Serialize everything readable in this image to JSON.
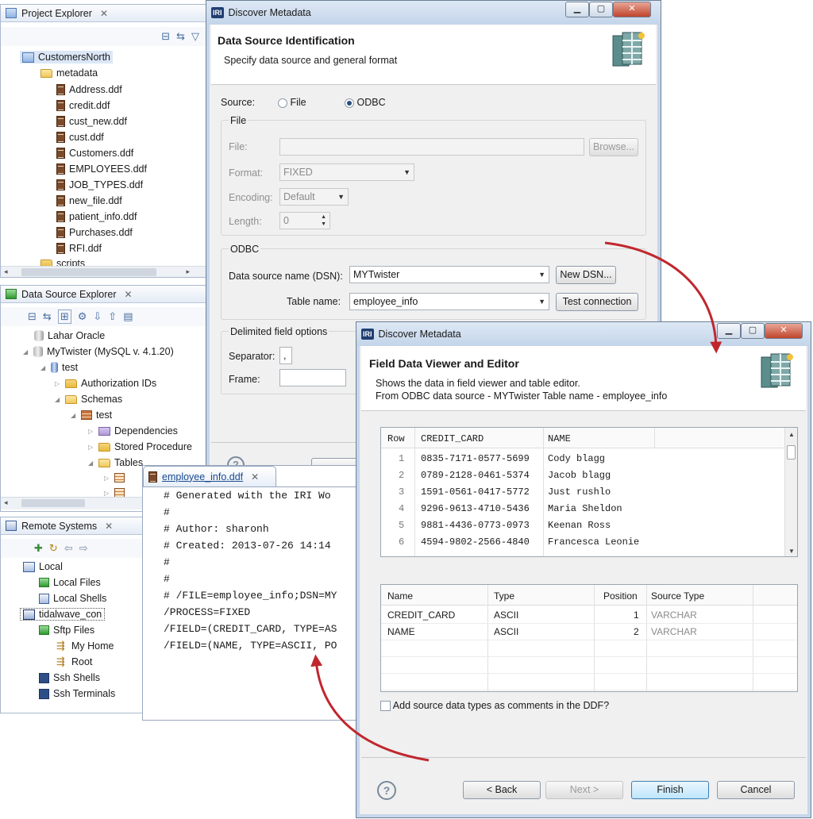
{
  "project_explorer": {
    "title": "Project Explorer",
    "project": "CustomersNorth",
    "folder": "metadata",
    "files": [
      "Address.ddf",
      "credit.ddf",
      "cust_new.ddf",
      "cust.ddf",
      "Customers.ddf",
      "EMPLOYEES.ddf",
      "JOB_TYPES.ddf",
      "new_file.ddf",
      "patient_info.ddf",
      "Purchases.ddf",
      "RFI.ddf"
    ],
    "partial_folder": "scripts"
  },
  "data_source_explorer": {
    "title": "Data Source Explorer",
    "items": [
      "Lahar Oracle",
      "MyTwister (MySQL v. 4.1.20)",
      "test",
      "Authorization IDs",
      "Schemas",
      "test",
      "Dependencies",
      "Stored Procedure",
      "Tables"
    ]
  },
  "remote_systems": {
    "title": "Remote Systems",
    "items": [
      "Local",
      "Local Files",
      "Local Shells",
      "tidalwave_con",
      "Sftp Files",
      "My Home",
      "Root",
      "Ssh Shells",
      "Ssh Terminals"
    ]
  },
  "discover_dialog": {
    "window_title": "Discover Metadata",
    "banner_title": "Data Source Identification",
    "banner_subtitle": "Specify data source and general format",
    "source_label": "Source:",
    "source_file": "File",
    "source_odbc": "ODBC",
    "file_group": "File",
    "file_label": "File:",
    "browse": "Browse...",
    "format_label": "Format:",
    "format_value": "FIXED",
    "encoding_label": "Encoding:",
    "encoding_value": "Default",
    "length_label": "Length:",
    "length_value": "0",
    "odbc_group": "ODBC",
    "dsn_label": "Data source name (DSN):",
    "dsn_value": "MYTwister",
    "new_dsn": "New DSN...",
    "table_label": "Table name:",
    "table_value": "employee_info",
    "test_connection": "Test connection",
    "delimited_group": "Delimited field options",
    "separator_label": "Separator:",
    "separator_value": ",",
    "frame_label": "Frame:"
  },
  "editor": {
    "tab": "employee_info.ddf",
    "lines": [
      "# Generated with the IRI Wo",
      "#",
      "# Author: sharonh",
      "# Created: 2013-07-26 14:14",
      "#",
      "#",
      "# /FILE=employee_info;DSN=MY",
      "/PROCESS=FIXED",
      "/FIELD=(CREDIT_CARD, TYPE=AS",
      "/FIELD=(NAME, TYPE=ASCII, PO"
    ]
  },
  "field_dialog": {
    "window_title": "Discover Metadata",
    "banner_title": "Field Data Viewer and Editor",
    "banner_line1": "Shows the data in field viewer and table editor.",
    "banner_line2": "From ODBC data source - MYTwister Table name - employee_info",
    "data_headers": [
      "Row",
      "CREDIT_CARD",
      "NAME"
    ],
    "data_rows": [
      [
        "1",
        "0835-7171-0577-5699",
        "Cody blagg"
      ],
      [
        "2",
        "0789-2128-0461-5374",
        "Jacob blagg"
      ],
      [
        "3",
        "1591-0561-0417-5772",
        "Just rushlo"
      ],
      [
        "4",
        "9296-9613-4710-5436",
        "Maria Sheldon"
      ],
      [
        "5",
        "9881-4436-0773-0973",
        "Keenan Ross"
      ],
      [
        "6",
        "4594-9802-2566-4840",
        "Francesca Leonie"
      ]
    ],
    "field_headers": [
      "Name",
      "Type",
      "Position",
      "Source Type"
    ],
    "field_rows": [
      [
        "CREDIT_CARD",
        "ASCII",
        "1",
        "VARCHAR"
      ],
      [
        "NAME",
        "ASCII",
        "2",
        "VARCHAR"
      ]
    ],
    "checkbox_label": "Add source data types as comments in the DDF?",
    "back": "< Back",
    "next": "Next >",
    "finish": "Finish",
    "cancel": "Cancel",
    "help": "?"
  },
  "colors": {
    "arrow": "#c0272d",
    "accent": "#3c7fb1"
  }
}
